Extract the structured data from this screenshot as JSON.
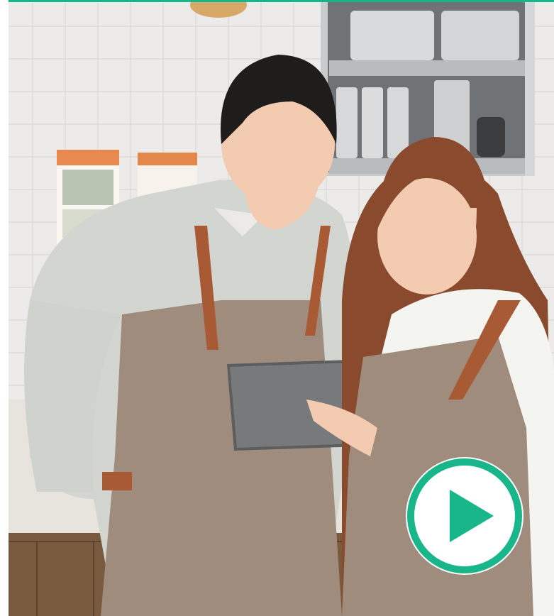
{
  "colors": {
    "accent": "#19b58b",
    "tile_wall": "#ecebe9",
    "apron": "#a08c7c",
    "strap": "#a85a35",
    "shirt_white": "#f4f4f1",
    "shirt_grey": "#cfd1cd"
  },
  "hero": {
    "image_label": "two-cafe-staff-looking-at-tablet"
  },
  "play_button": {
    "icon": "play-icon"
  }
}
